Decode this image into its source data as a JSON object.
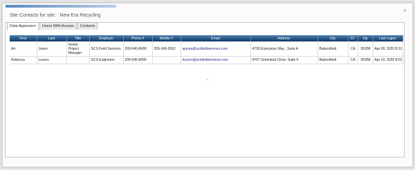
{
  "dialog": {
    "title_label": "Site Contacts for site:",
    "site_name": "New Era Recycling",
    "close_symbol": "×"
  },
  "tabs": [
    "Data Approvers",
    "Users With Access",
    "Contacts"
  ],
  "columns": [
    "First",
    "Last",
    "Title",
    "Employer",
    "Phone #",
    "Mobile #",
    "Email",
    "Address",
    "City",
    "ST",
    "Zip",
    "Last Logon"
  ],
  "rows": [
    {
      "first": "Art",
      "last": "Jones",
      "title": "Senior Project Manager",
      "employer": "SCS Field Services",
      "phone": "209-545-8490",
      "mobile": "209-345-2062",
      "email": "ajones@scsfieldservices.com",
      "address": "4730 Enterprise Way , Suite A",
      "city": "Bakersfield",
      "st": "CA",
      "zip": "95358",
      "last_logon": "Apr 09, 2020 8:31 AM"
    },
    {
      "first": "Rebecca",
      "last": "Lucero",
      "title": "",
      "employer": "SCS Engineers",
      "phone": "209-545-8490",
      "mobile": "",
      "email": "rlucero@scsfieldservices.com",
      "address": "4707 Greenleaf Circle, Suite F",
      "city": "Bakersfield",
      "st": "CA",
      "zip": "95358",
      "last_logon": "Apr 10, 2020 8:01 AM"
    }
  ]
}
